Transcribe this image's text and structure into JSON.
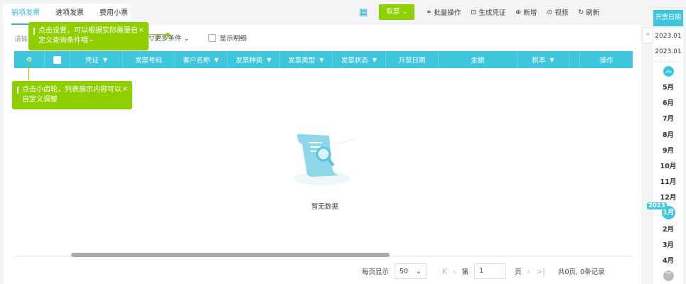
{
  "tabs": [
    "销项发票",
    "进项发票",
    "费用小票"
  ],
  "toolbar": {
    "fetch": "取票",
    "batch": "批量操作",
    "voucher": "生成凭证",
    "add": "新增",
    "video": "视频",
    "refresh": "刷新"
  },
  "filter": {
    "placeholder": "请输入",
    "more": "更多条件",
    "show_detail": "显示明细"
  },
  "table": {
    "columns": [
      "凭证",
      "发票号码",
      "客户名称",
      "发票种类",
      "发票类型",
      "发票状态",
      "开票日期",
      "金额",
      "税率",
      "",
      "操作"
    ]
  },
  "tips": {
    "settings": "点击设置，可以根据实际需要自定义查询条件哦~",
    "gear": "点击小齿轮，列表展示内容可以自定义调整",
    "close": "×"
  },
  "empty": {
    "text": "暂无数据"
  },
  "pager": {
    "per_page_label": "每页显示",
    "per_page": "50",
    "page_prefix": "第",
    "page": "1",
    "page_suffix": "页",
    "summary": "共0页, 0条记录"
  },
  "timeline": {
    "header": "开票日期",
    "start": "2023.01",
    "end": "2023.01",
    "year": "2023",
    "months_before": [
      "5月",
      "6月",
      "7月",
      "8月",
      "9月",
      "10月",
      "11月",
      "12月"
    ],
    "current": "1月",
    "months_after": [
      "2月",
      "3月",
      "4月"
    ]
  },
  "colors": {
    "accent": "#3fc6dc",
    "tip": "#8fcf00"
  }
}
